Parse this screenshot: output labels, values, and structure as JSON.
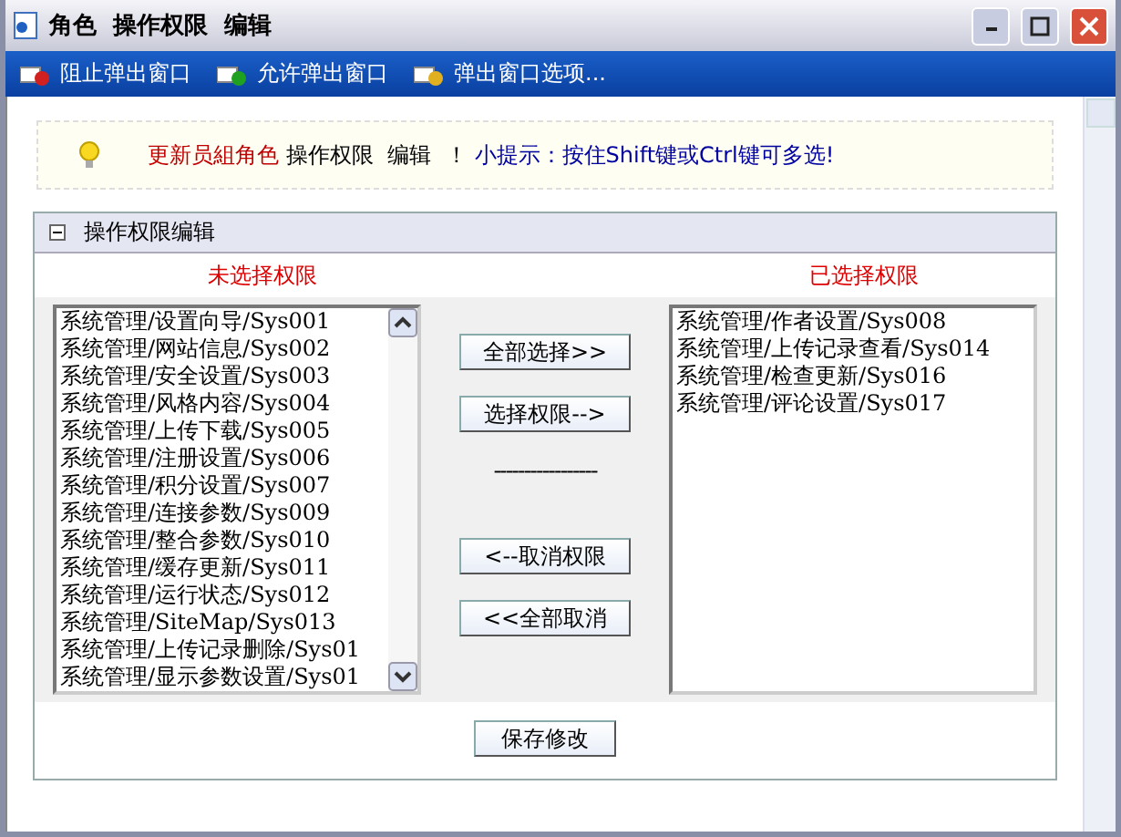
{
  "window": {
    "title": "角色  操作权限  编辑"
  },
  "toolbar": [
    "阻止弹出窗口",
    "允许弹出窗口",
    "弹出窗口选项..."
  ],
  "tip": {
    "role": "更新员組角色",
    "action": "操作权限  编辑  ！",
    "hint": "小提示：按住Shift键或Ctrl键可多选!"
  },
  "panel": {
    "title": "操作权限编辑",
    "unselected": {
      "heading": "未选择权限",
      "items": [
        "系统管理/设置向导/Sys001",
        "系统管理/网站信息/Sys002",
        "系统管理/安全设置/Sys003",
        "系统管理/风格内容/Sys004",
        "系统管理/上传下载/Sys005",
        "系统管理/注册设置/Sys006",
        "系统管理/积分设置/Sys007",
        "系统管理/连接参数/Sys009",
        "系统管理/整合参数/Sys010",
        "系统管理/缓存更新/Sys011",
        "系统管理/运行状态/Sys012",
        "系统管理/SiteMap/Sys013",
        "系统管理/上传记录删除/Sys01",
        "系统管理/显示参数设置/Sys01"
      ]
    },
    "selected": {
      "heading": "已选择权限",
      "items": [
        "系统管理/作者设置/Sys008",
        "系统管理/上传记录查看/Sys014",
        "系统管理/检查更新/Sys016",
        "系统管理/评论设置/Sys017"
      ]
    },
    "buttons_top": [
      "全部选择>>",
      "选择权限-->"
    ],
    "separator": "-----------------",
    "buttons_bottom": [
      "<--取消权限",
      "<<全部取消"
    ],
    "save": "保存修改"
  }
}
